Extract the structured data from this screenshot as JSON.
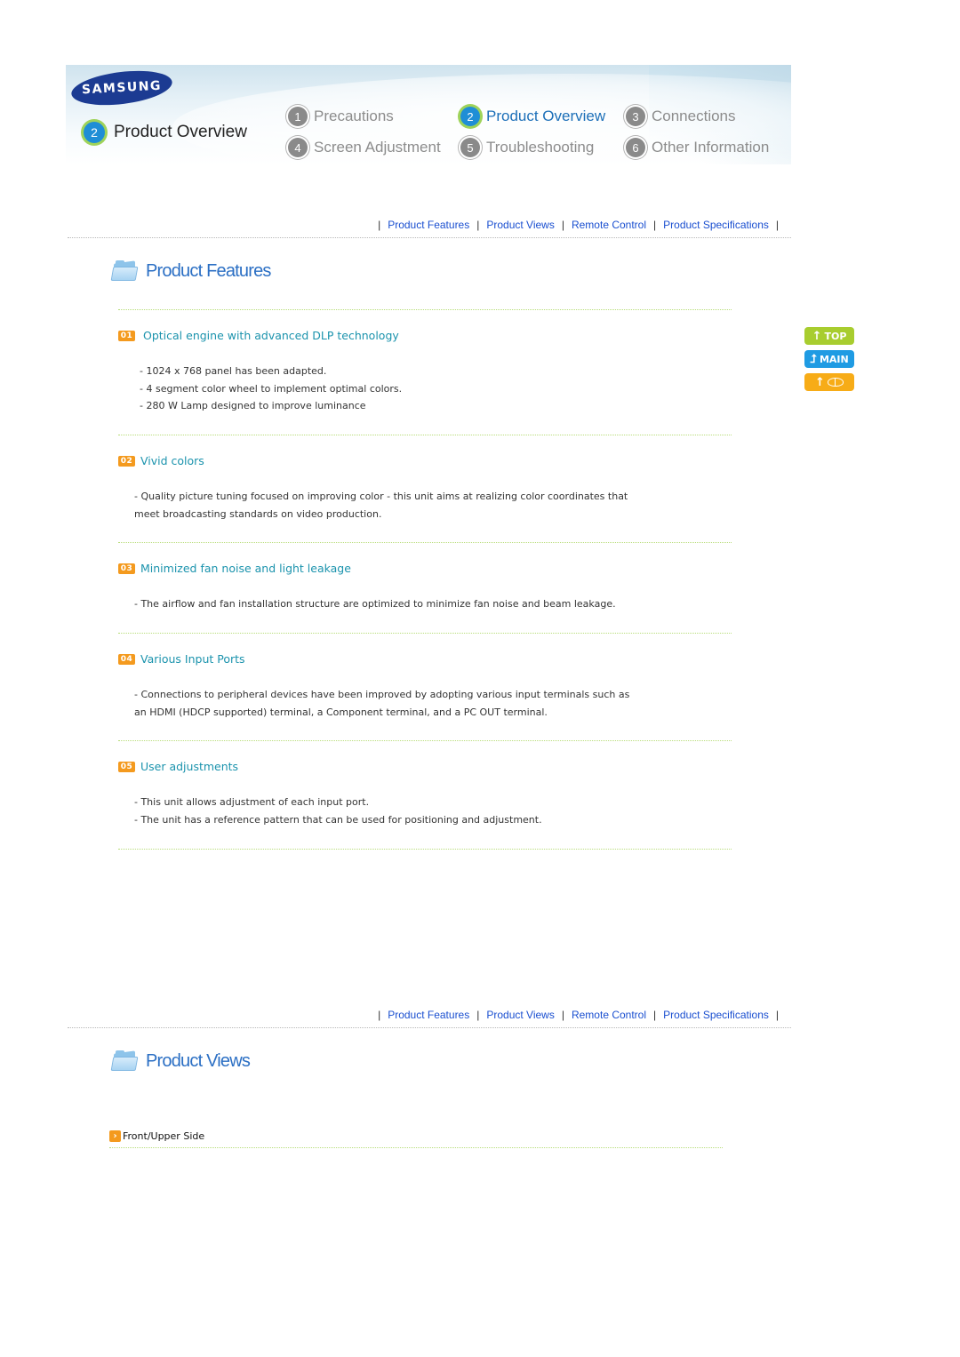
{
  "header": {
    "brand": "SAMSUNG",
    "current_chapter": {
      "number": "2",
      "label": "Product Overview"
    },
    "chapters": [
      {
        "number": "1",
        "label": "Precautions",
        "active": false
      },
      {
        "number": "2",
        "label": "Product Overview",
        "active": true
      },
      {
        "number": "3",
        "label": "Connections",
        "active": false
      },
      {
        "number": "4",
        "label": "Screen Adjustment",
        "active": false
      },
      {
        "number": "5",
        "label": "Troubleshooting",
        "active": false
      },
      {
        "number": "6",
        "label": "Other Information",
        "active": false
      }
    ]
  },
  "subnav": {
    "separator": "|",
    "links": [
      "Product Features",
      "Product Views",
      "Remote Control",
      "Product Specifications"
    ]
  },
  "features_section": {
    "title": "Product Features",
    "items": [
      {
        "badge": "01",
        "title": "Optical engine with advanced DLP technology",
        "lines": [
          "- 1024 x 768 panel has been adapted.",
          "- 4 segment color wheel to implement optimal colors.",
          "- 280 W Lamp designed to improve luminance"
        ]
      },
      {
        "badge": "02",
        "title": "Vivid colors",
        "lines": [
          "- Quality picture tuning focused on improving color - this unit aims at realizing color coordinates that",
          "meet broadcasting standards on video production."
        ]
      },
      {
        "badge": "03",
        "title": "Minimized fan noise and light leakage",
        "lines": [
          "- The airflow and fan installation structure are optimized to minimize fan noise and beam leakage."
        ]
      },
      {
        "badge": "04",
        "title": "Various Input Ports",
        "lines": [
          "- Connections to peripheral devices have been improved by adopting various input terminals such as",
          "an HDMI (HDCP supported) terminal, a Component terminal, and a PC OUT terminal."
        ]
      },
      {
        "badge": "05",
        "title": "User adjustments",
        "lines": [
          "- This unit allows adjustment of each input port.",
          "- The unit has a reference pattern that can be used for positioning and adjustment."
        ]
      }
    ]
  },
  "side_buttons": {
    "top": {
      "label": "TOP",
      "icon": "arrow-up"
    },
    "main": {
      "label": "MAIN",
      "icon": "arrow-turn-up"
    },
    "back": {
      "label": "",
      "icon": "arrow-up-book"
    }
  },
  "views_section": {
    "title": "Product Views",
    "items": [
      {
        "icon": "chevron-right",
        "label": "Front/Upper Side"
      }
    ]
  },
  "icons": {
    "arrow_up": "↑",
    "chevron_right": "›"
  }
}
